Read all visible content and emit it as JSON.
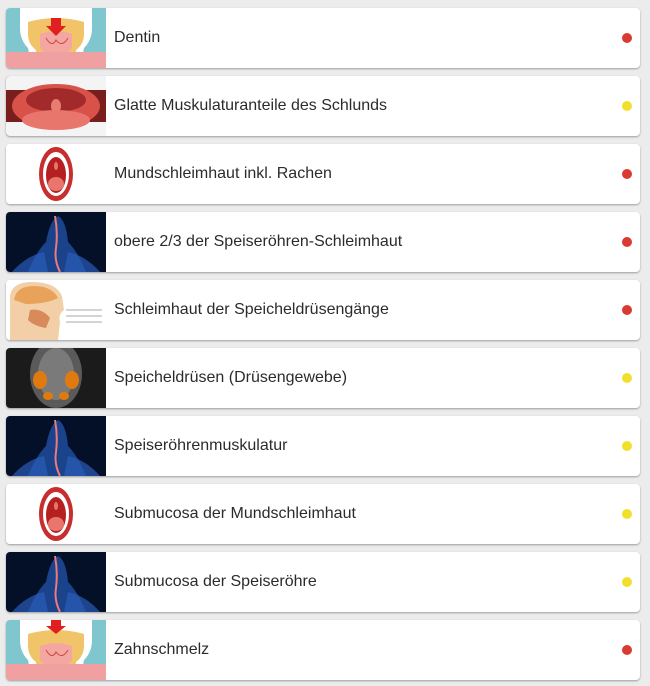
{
  "status_colors": {
    "red": "#d93a32",
    "yellow": "#f2df2c"
  },
  "items": [
    {
      "label": "Dentin",
      "image": "tooth-dentin-icon",
      "status": "red"
    },
    {
      "label": "Glatte Muskulaturanteile des Schlunds",
      "image": "throat-pharynx-icon",
      "status": "yellow"
    },
    {
      "label": "Mundschleimhaut inkl. Rachen",
      "image": "open-mouth-icon",
      "status": "red"
    },
    {
      "label": "obere 2/3 der Speiseröhren-Schleimhaut",
      "image": "esophagus-body-icon",
      "status": "red"
    },
    {
      "label": "Schleimhaut der Speicheldrüsengänge",
      "image": "head-section-icon",
      "status": "red"
    },
    {
      "label": "Speicheldrüsen (Drüsengewebe)",
      "image": "face-salivary-glands-icon",
      "status": "yellow"
    },
    {
      "label": "Speiseröhrenmuskulatur",
      "image": "esophagus-body-icon",
      "status": "yellow"
    },
    {
      "label": "Submucosa der Mundschleimhaut",
      "image": "open-mouth-icon",
      "status": "yellow"
    },
    {
      "label": "Submucosa der Speiseröhre",
      "image": "esophagus-body-icon",
      "status": "yellow"
    },
    {
      "label": "Zahnschmelz",
      "image": "tooth-enamel-icon",
      "status": "red"
    }
  ]
}
